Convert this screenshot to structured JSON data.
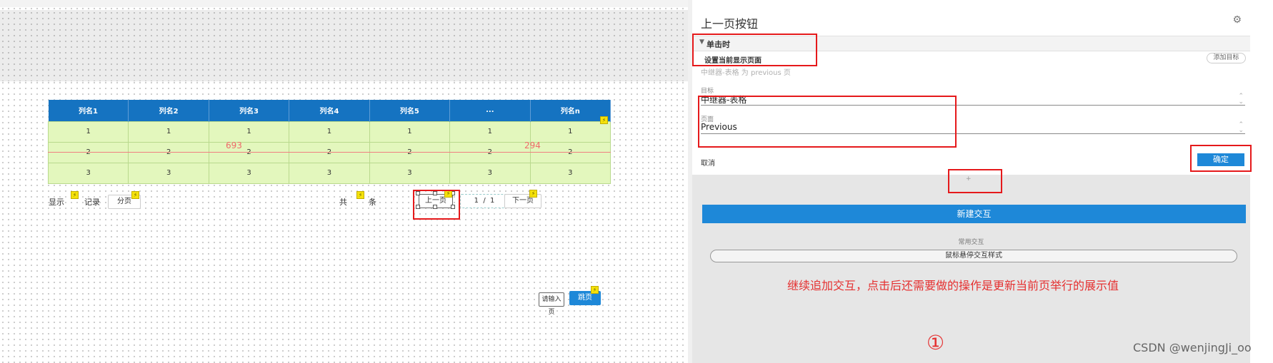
{
  "table": {
    "headers": [
      "列名1",
      "列名2",
      "列名3",
      "列名4",
      "列名5",
      "...",
      "列名n"
    ],
    "rows": [
      [
        "1",
        "1",
        "1",
        "1",
        "1",
        "1",
        "1"
      ],
      [
        "2",
        "2",
        "2",
        "2",
        "2",
        "2",
        "2"
      ],
      [
        "3",
        "3",
        "3",
        "3",
        "3",
        "3",
        "3"
      ]
    ]
  },
  "dims": {
    "d1": "693",
    "d2": "294"
  },
  "pager": {
    "show": "显示",
    "records": "记录",
    "page_size_btn": "分页",
    "total": "共",
    "item": "条",
    "prev": "上一页",
    "cur": "1",
    "sep": "/",
    "total_pages": "1",
    "next": "下一页",
    "input_placeholder": "请输入页",
    "jump": "跳页"
  },
  "flag_glyph": "⚡",
  "panel": {
    "title": "上一页按钮",
    "settings_icon": "sliders-icon",
    "event": "单击时",
    "action": "设置当前显示页面",
    "add_target": "添加目标",
    "action_desc": "中继器-表格 为 previous 页",
    "target_label": "目标",
    "target_value": "中继器-表格",
    "page_label": "页面",
    "page_value": "Previous",
    "cancel": "取消",
    "ok": "确定",
    "plus": "+",
    "new_interaction": "新建交互",
    "common_interactions": "常用交互",
    "hover_style": "鼠标悬停交互样式"
  },
  "note": "继续追加交互，点击后还需要做的操作是更新当前页举行的展示值",
  "circle_marker": "①",
  "watermark": "CSDN @wenjingJi_oo",
  "colors": {
    "accent": "#1e88d8",
    "header": "#1573c1",
    "cell": "#e3f7bd",
    "annotation": "#e5191b"
  }
}
